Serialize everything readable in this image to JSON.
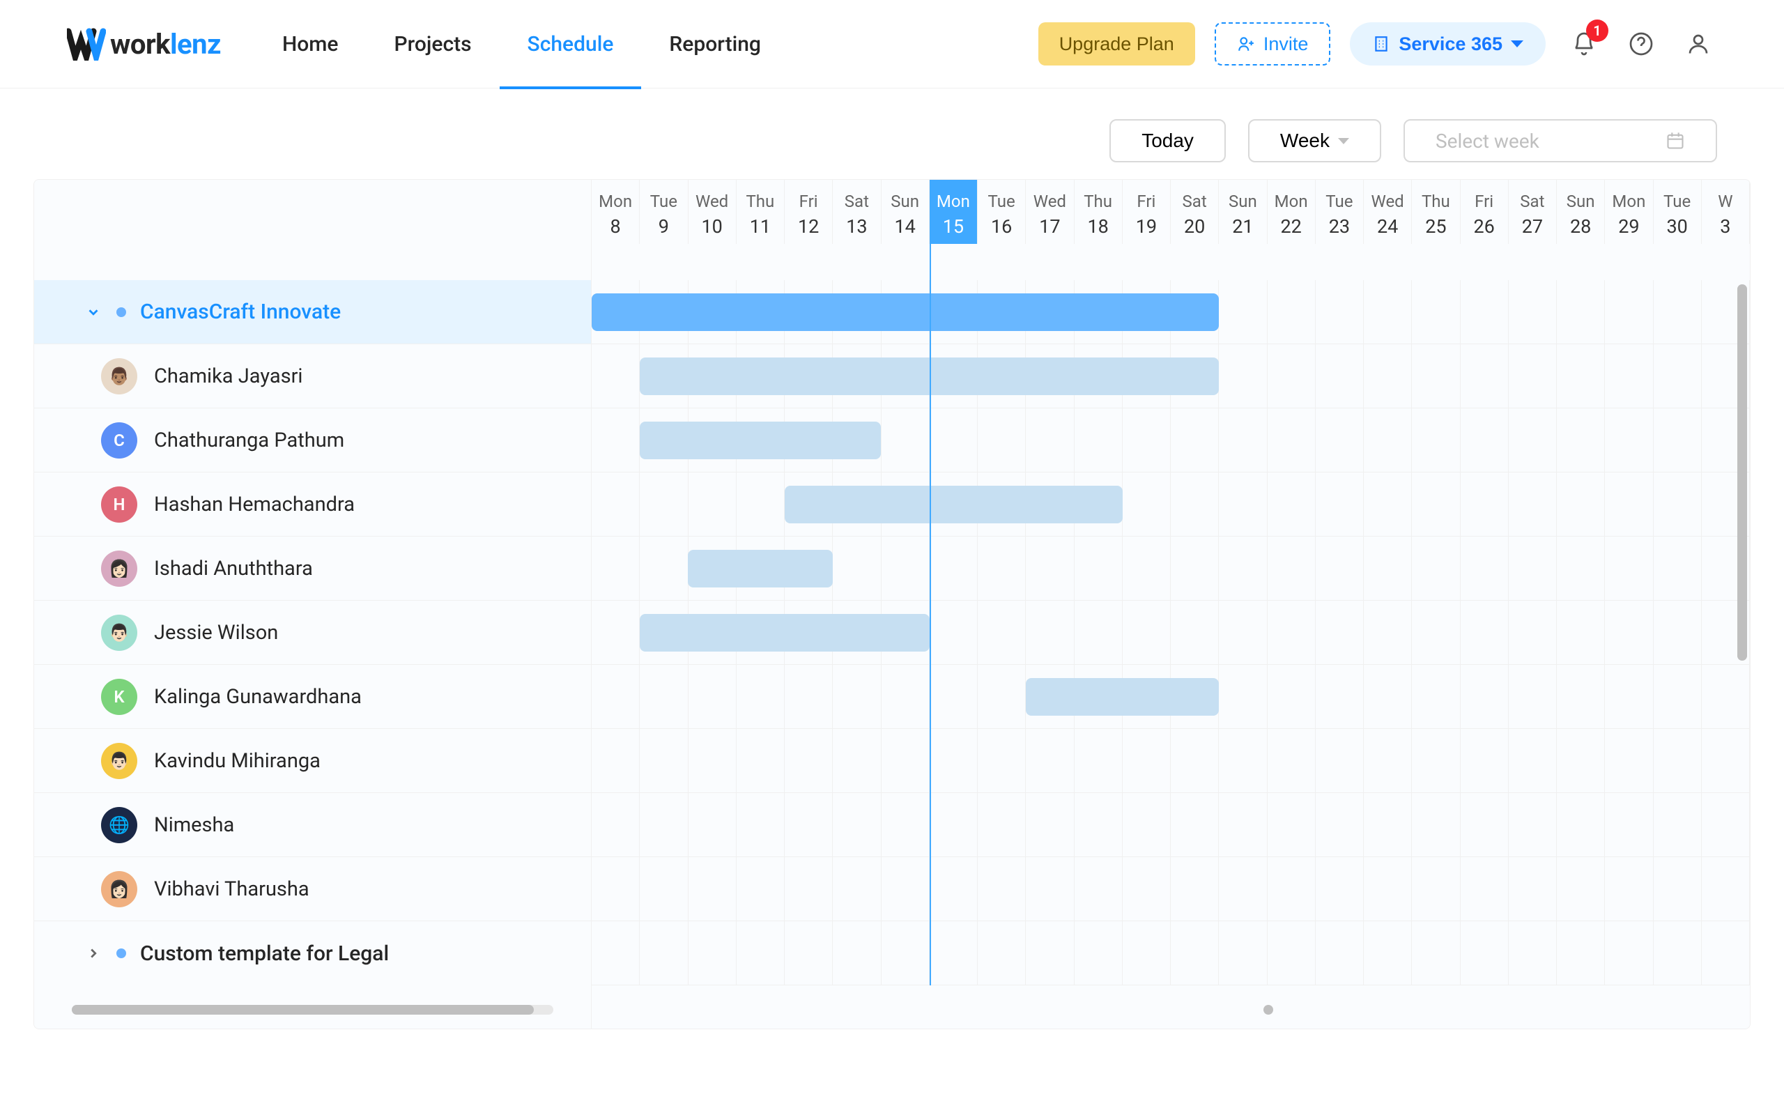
{
  "header": {
    "logo_work": "work",
    "logo_lenz": "lenz",
    "nav": [
      "Home",
      "Projects",
      "Schedule",
      "Reporting"
    ],
    "nav_active": 2,
    "upgrade": "Upgrade Plan",
    "invite": "Invite",
    "service": "Service 365",
    "notif_count": "1"
  },
  "toolbar": {
    "today": "Today",
    "view": "Week",
    "week_placeholder": "Select week"
  },
  "projects": [
    {
      "name": "CanvasCraft Innovate",
      "expanded": true
    },
    {
      "name": "Custom template for Legal",
      "expanded": false
    }
  ],
  "members": [
    {
      "name": "Chamika Jayasri",
      "avatar_bg": "#e8d9c8",
      "avatar_text": "👨🏽",
      "bar": {
        "start": 1,
        "span": 12
      }
    },
    {
      "name": "Chathuranga Pathum",
      "avatar_bg": "#5b8ef7",
      "avatar_text": "C",
      "bar": {
        "start": 1,
        "span": 5
      }
    },
    {
      "name": "Hashan Hemachandra",
      "avatar_bg": "#e06777",
      "avatar_text": "H",
      "bar": {
        "start": 4,
        "span": 7
      }
    },
    {
      "name": "Ishadi Anuththara",
      "avatar_bg": "#d8a8c0",
      "avatar_text": "👩🏻",
      "bar": {
        "start": 2,
        "span": 3
      }
    },
    {
      "name": "Jessie Wilson",
      "avatar_bg": "#a0e0d0",
      "avatar_text": "👨🏻",
      "bar": {
        "start": 1,
        "span": 6
      }
    },
    {
      "name": "Kalinga Gunawardhana",
      "avatar_bg": "#7bd37b",
      "avatar_text": "K",
      "bar": {
        "start": 9,
        "span": 4
      }
    },
    {
      "name": "Kavindu Mihiranga",
      "avatar_bg": "#f5c842",
      "avatar_text": "👨🏻",
      "bar": null
    },
    {
      "name": "Nimesha",
      "avatar_bg": "#1a2847",
      "avatar_text": "🌐",
      "bar": null
    },
    {
      "name": "Vibhavi Tharusha",
      "avatar_bg": "#f0b080",
      "avatar_text": "👩🏻",
      "bar": null
    }
  ],
  "project_bar": {
    "start": 0,
    "span": 13
  },
  "days": [
    {
      "dow": "Mon",
      "num": "8"
    },
    {
      "dow": "Tue",
      "num": "9"
    },
    {
      "dow": "Wed",
      "num": "10"
    },
    {
      "dow": "Thu",
      "num": "11"
    },
    {
      "dow": "Fri",
      "num": "12"
    },
    {
      "dow": "Sat",
      "num": "13"
    },
    {
      "dow": "Sun",
      "num": "14"
    },
    {
      "dow": "Mon",
      "num": "15",
      "today": true
    },
    {
      "dow": "Tue",
      "num": "16"
    },
    {
      "dow": "Wed",
      "num": "17"
    },
    {
      "dow": "Thu",
      "num": "18"
    },
    {
      "dow": "Fri",
      "num": "19"
    },
    {
      "dow": "Sat",
      "num": "20"
    },
    {
      "dow": "Sun",
      "num": "21"
    },
    {
      "dow": "Mon",
      "num": "22"
    },
    {
      "dow": "Tue",
      "num": "23"
    },
    {
      "dow": "Wed",
      "num": "24"
    },
    {
      "dow": "Thu",
      "num": "25"
    },
    {
      "dow": "Fri",
      "num": "26"
    },
    {
      "dow": "Sat",
      "num": "27"
    },
    {
      "dow": "Sun",
      "num": "28"
    },
    {
      "dow": "Mon",
      "num": "29"
    },
    {
      "dow": "Tue",
      "num": "30"
    },
    {
      "dow": "W",
      "num": "3"
    }
  ]
}
